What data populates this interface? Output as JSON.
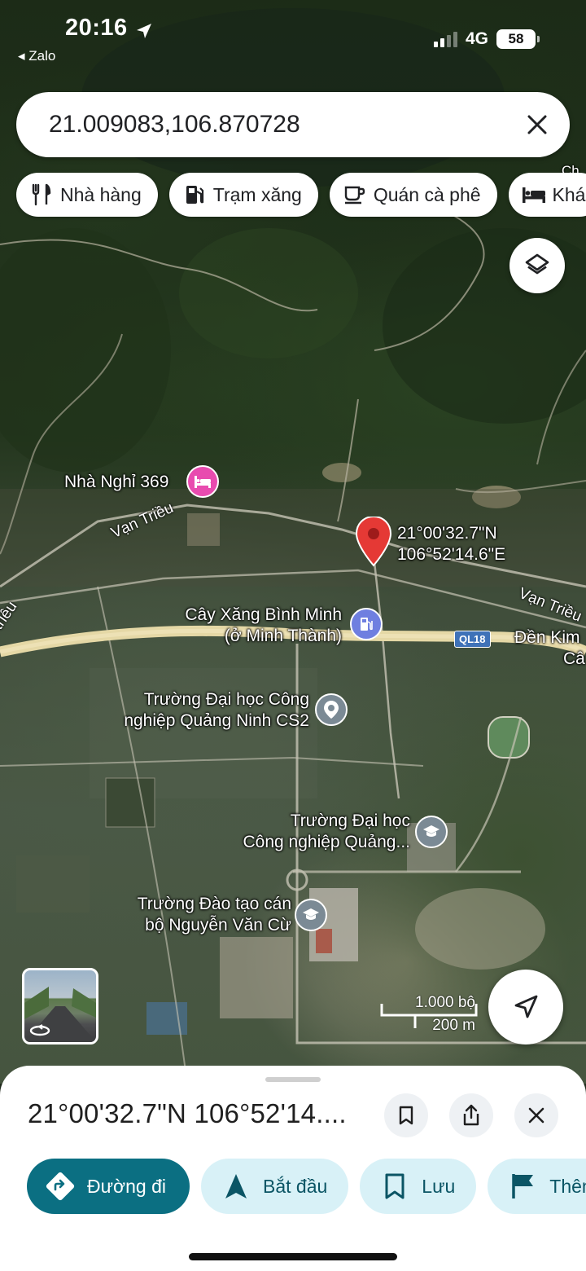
{
  "status_bar": {
    "time": "20:16",
    "back_app": "Zalo",
    "network": "4G",
    "battery": "58"
  },
  "search": {
    "value": "21.009083,106.870728"
  },
  "chips": [
    {
      "label": "Nhà hàng",
      "icon": "restaurant-icon"
    },
    {
      "label": "Trạm xăng",
      "icon": "gas-station-icon"
    },
    {
      "label": "Quán cà phê",
      "icon": "coffee-icon"
    },
    {
      "label": "Khá",
      "icon": "hotel-icon"
    }
  ],
  "map": {
    "pin_coords_line1": "21°00'32.7\"N",
    "pin_coords_line2": "106°52'14.6\"E",
    "labels": {
      "nha_nghi": "Nhà Nghỉ 369",
      "cay_xang_line1": "Cây Xăng Bình Minh",
      "cay_xang_line2": "(ở Minh Thành)",
      "truong_cn_cs2_line1": "Trường Đại học Công",
      "truong_cn_cs2_line2": "nghiệp Quảng Ninh CS2",
      "truong_cn_line1": "Trường Đại học",
      "truong_cn_line2": "Công nghiệp Quảng...",
      "truong_dt_line1": "Trường Đào tạo cán",
      "truong_dt_line2": "bộ Nguyễn Văn Cừ",
      "den_kim_line1": "Đền Kim",
      "den_kim_line2": "Câ"
    },
    "roads": {
      "van_trieu": "Vạn Triều",
      "van_trieu_2": "Vạn Triều",
      "trieu": "triều",
      "ql18": "QL18",
      "top_fragment": "Ch"
    },
    "scale": {
      "feet": "1.000 bộ",
      "meters": "200 m"
    }
  },
  "sheet": {
    "title": "21°00'32.7\"N 106°52'14....",
    "actions": [
      {
        "label": "Đường đi",
        "icon": "directions-icon"
      },
      {
        "label": "Bắt đầu",
        "icon": "navigation-icon"
      },
      {
        "label": "Lưu",
        "icon": "bookmark-icon"
      },
      {
        "label": "Thêm",
        "icon": "flag-icon"
      }
    ]
  },
  "colors": {
    "primary_action": "#0b6f82",
    "secondary_action": "#d8f1f7",
    "pin": "#e53935",
    "poi_pink": "#e84baf",
    "poi_blue": "#6f7fe0",
    "poi_grey": "#7b8a95"
  }
}
